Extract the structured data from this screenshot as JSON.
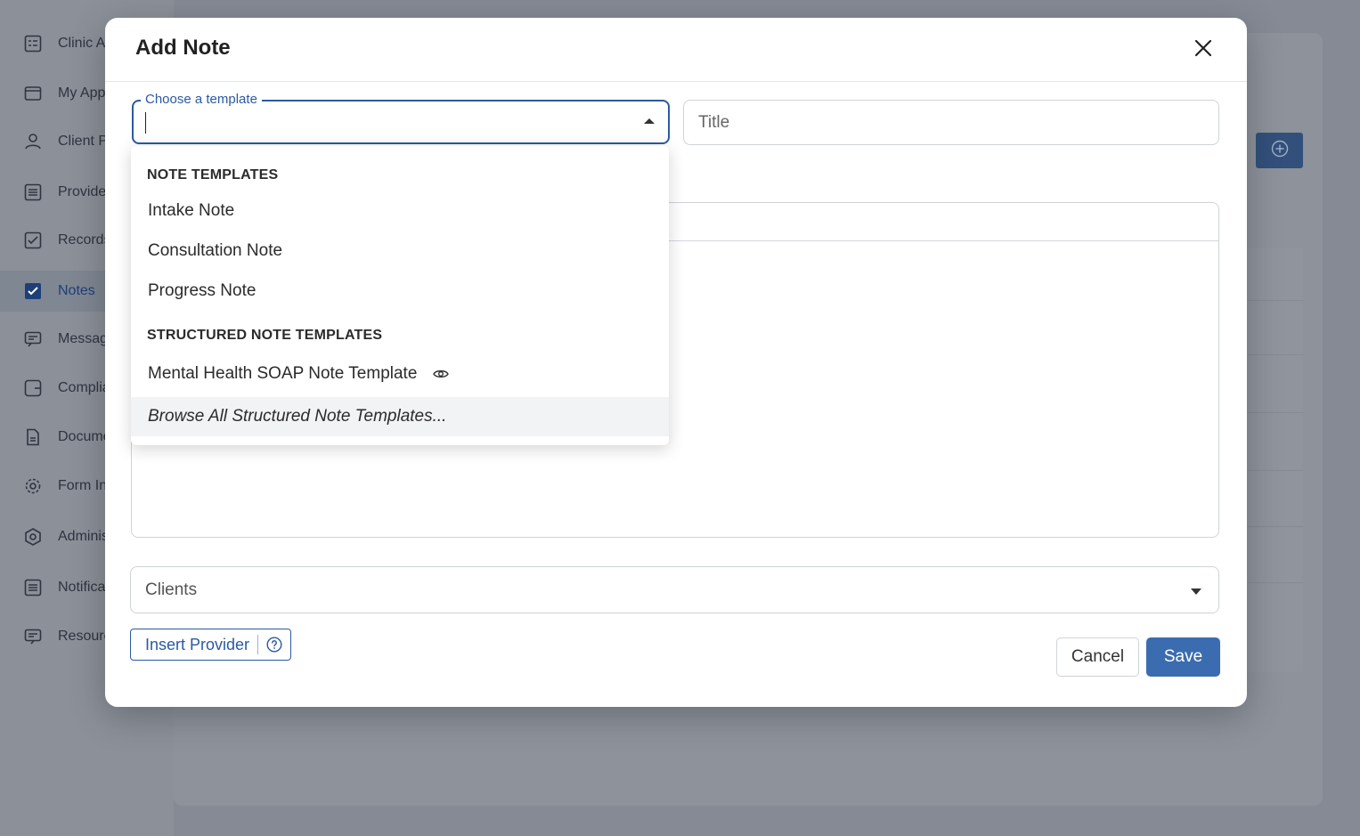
{
  "sidebar": {
    "items": [
      {
        "label": "Clinic A",
        "icon": "dashboard-icon"
      },
      {
        "label": "My Appointments",
        "icon": "calendar-icon"
      },
      {
        "label": "Client Profiles",
        "icon": "client-icon"
      },
      {
        "label": "Providers",
        "icon": "list-icon"
      },
      {
        "label": "Records",
        "icon": "records-icon"
      },
      {
        "label": "Notes",
        "icon": "checkbox-icon"
      },
      {
        "label": "Messages",
        "icon": "message-icon"
      },
      {
        "label": "Compliance",
        "icon": "compliance-icon"
      },
      {
        "label": "Documents",
        "icon": "document-icon"
      },
      {
        "label": "Form Intake",
        "icon": "gear-icon"
      },
      {
        "label": "Administration",
        "icon": "admin-gear-icon"
      },
      {
        "label": "Notifications",
        "icon": "notification-icon"
      },
      {
        "label": "Resources",
        "icon": "resources-icon"
      }
    ]
  },
  "modal": {
    "title": "Add Note",
    "template_label": "Choose a template",
    "title_placeholder": "Title",
    "clients_placeholder": "Clients",
    "insert_provider_label": "Insert Provider",
    "cancel_label": "Cancel",
    "save_label": "Save"
  },
  "dropdown": {
    "groups": [
      {
        "label": "NOTE TEMPLATES",
        "items": [
          "Intake Note",
          "Consultation Note",
          "Progress Note"
        ]
      },
      {
        "label": "STRUCTURED NOTE TEMPLATES",
        "items": [
          "Mental Health SOAP Note Template"
        ]
      }
    ],
    "browse_all": "Browse All Structured Note Templates..."
  },
  "colors": {
    "accent": "#3b6cb0",
    "focus_border": "#2b5aa0",
    "overlay": "#858a95"
  }
}
